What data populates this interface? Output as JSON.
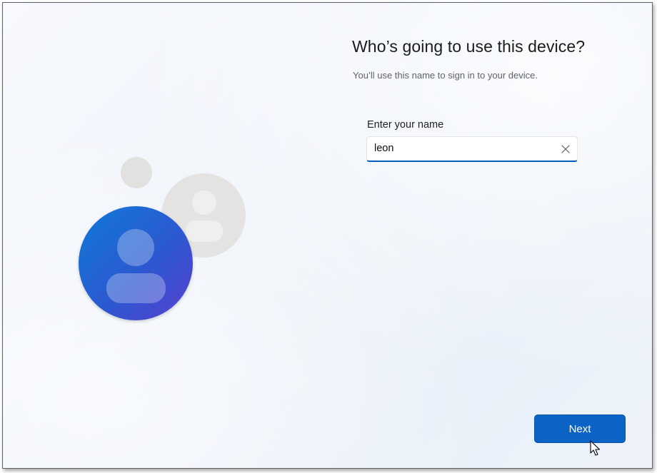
{
  "setup": {
    "title": "Who’s going to use this device?",
    "subtitle": "You’ll use this name to sign in to your device.",
    "name_field": {
      "label": "Enter your name",
      "value": "leon"
    },
    "next_label": "Next"
  },
  "icons": {
    "clear": "close-icon",
    "illustration": "user-avatars-illustration",
    "pointer": "mouse-cursor"
  },
  "colors": {
    "accent": "#0b63c5",
    "input_underline": "#005fb8",
    "avatar_blue": "#1574d4",
    "avatar_purple": "#5b3fd1",
    "avatar_grey": "#e2e1e0"
  }
}
